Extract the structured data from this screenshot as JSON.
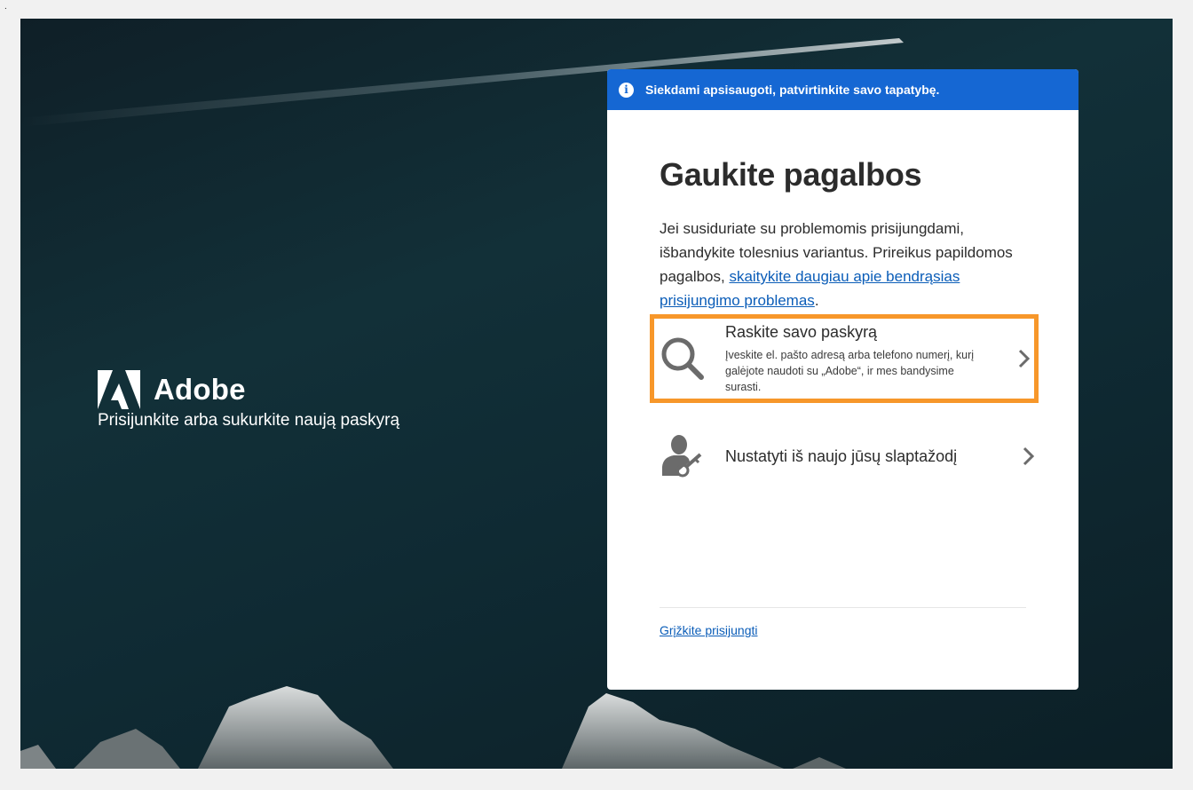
{
  "corner_mark": ".",
  "brand": {
    "name": "Adobe",
    "tagline": "Prisijunkite arba sukurkite naują paskyrą"
  },
  "banner": {
    "icon": "info-icon",
    "text": "Siekdami apsisaugoti, patvirtinkite savo tapatybę."
  },
  "card": {
    "title": "Gaukite pagalbos",
    "description": "Jei susiduriate su problemomis prisijungdami, išbandykite tolesnius variantus. Prireikus papildomos pagalbos, ",
    "link_text": "skaitykite daugiau apie bendrąsias prisijungimo problemas",
    "description_end": ".",
    "options": [
      {
        "icon": "search-icon",
        "title": "Raskite savo paskyrą",
        "subtitle": "Įveskite el. pašto adresą arba telefono numerį, kurį galėjote naudoti su „Adobe“, ir mes bandysime surasti.",
        "highlighted": true
      },
      {
        "icon": "user-key-icon",
        "title": "Nustatyti iš naujo jūsų slaptažodį",
        "subtitle": ""
      }
    ],
    "back_link": "Grįžkite prisijungti"
  },
  "colors": {
    "banner": "#1567d3",
    "highlight": "#f7972a",
    "link": "#0b5db8"
  }
}
